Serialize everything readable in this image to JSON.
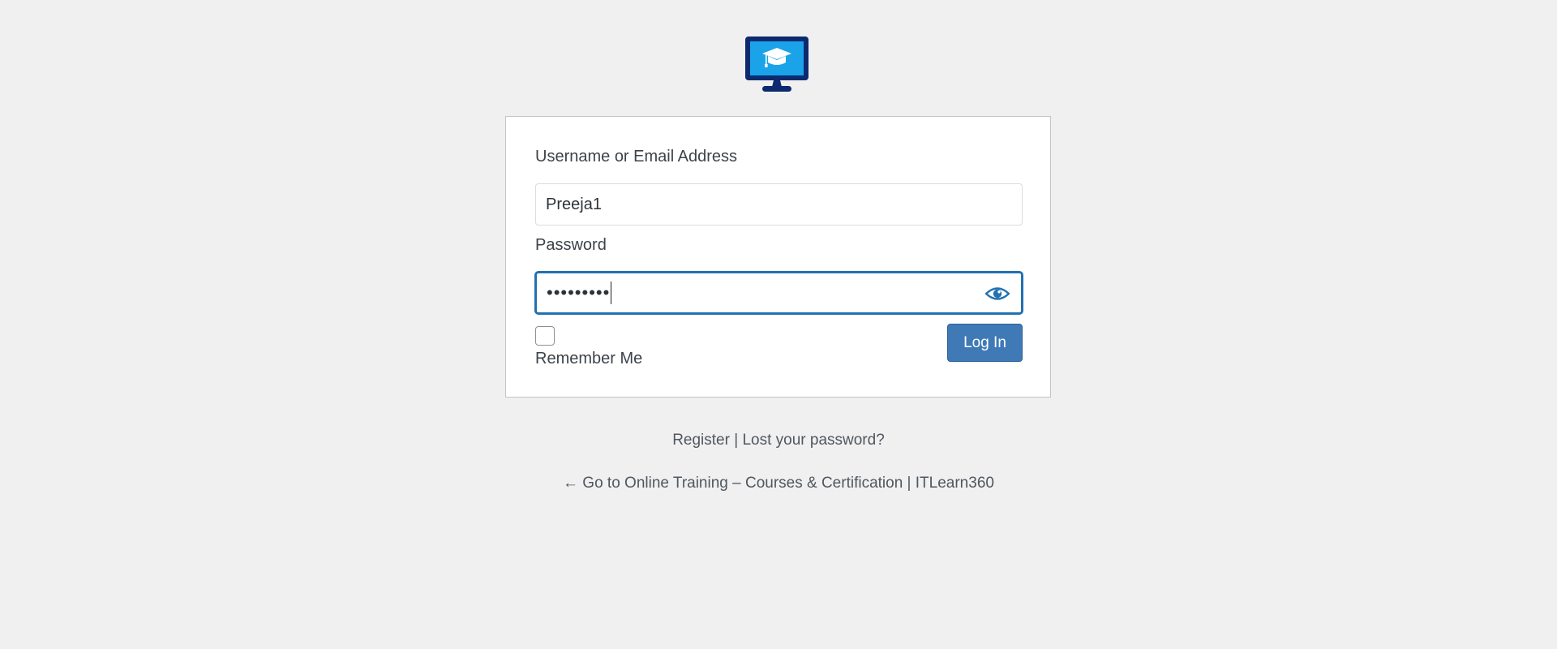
{
  "logo": {
    "icon": "monitor-graduation-cap-icon",
    "colors": {
      "frame": "#0d2a6e",
      "screen": "#1aa3e8",
      "cap": "#ffffff"
    }
  },
  "form": {
    "username_label": "Username or Email Address",
    "username_value": "Preeja1",
    "password_label": "Password",
    "password_masked": "•••••••••",
    "show_password_icon": "eye-icon",
    "remember_label": "Remember Me",
    "remember_checked": false,
    "login_label": "Log In"
  },
  "nav": {
    "register": "Register",
    "separator": "|",
    "lost_password": "Lost your password?",
    "back_link": "← Go to Online Training – Courses & Certification | ITLearn360"
  },
  "colors": {
    "accent": "#2271b1",
    "button": "#3f7ab7",
    "background": "#f0f0f1"
  }
}
